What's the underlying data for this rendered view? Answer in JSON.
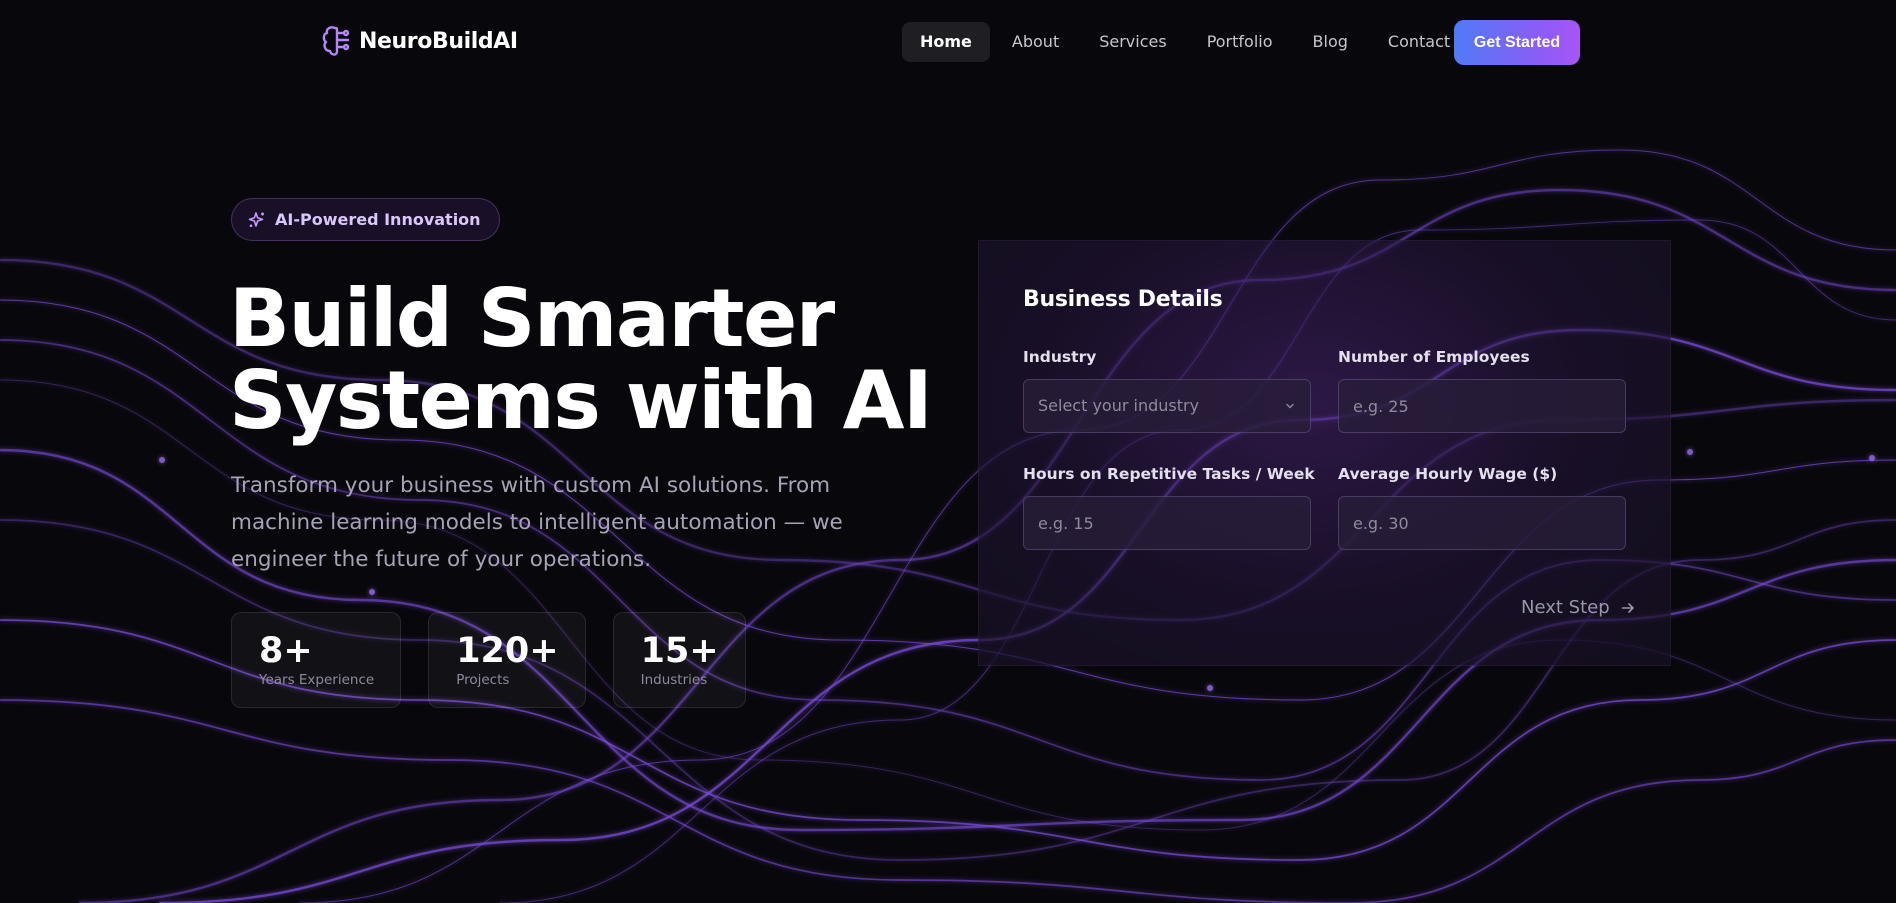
{
  "brand": {
    "name": "NeuroBuildAI"
  },
  "nav": {
    "links": [
      {
        "label": "Home",
        "active": true
      },
      {
        "label": "About",
        "active": false
      },
      {
        "label": "Services",
        "active": false
      },
      {
        "label": "Portfolio",
        "active": false
      },
      {
        "label": "Blog",
        "active": false
      },
      {
        "label": "Contact",
        "active": false
      }
    ],
    "cta_label": "Get Started"
  },
  "hero": {
    "badge": "AI-Powered Innovation",
    "headline_line1": "Build Smarter",
    "headline_line2": "Systems with AI",
    "subtext": "Transform your business with custom AI solutions. From machine learning models to intelligent automation — we engineer the future of your operations.",
    "stats": [
      {
        "value": "8+",
        "label": "Years Experience"
      },
      {
        "value": "120+",
        "label": "Projects"
      },
      {
        "value": "15+",
        "label": "Industries"
      }
    ]
  },
  "form": {
    "title": "Business Details",
    "industry": {
      "label": "Industry",
      "placeholder": "Select your industry"
    },
    "employees": {
      "label": "Number of Employees",
      "placeholder": "e.g. 25"
    },
    "hours": {
      "label": "Hours on Repetitive Tasks / Week",
      "placeholder": "e.g. 15"
    },
    "wage": {
      "label": "Average Hourly Wage ($)",
      "placeholder": "e.g. 30"
    },
    "next_label": "Next Step"
  },
  "colors": {
    "accent_start": "#4f7bf7",
    "accent_end": "#a855f7",
    "background": "#08070b",
    "wave": "#7c4ddb"
  },
  "icons": {
    "logo": "brain-icon",
    "badge": "sparkles-icon",
    "select": "chevron-down-icon",
    "next": "arrow-right-icon"
  }
}
